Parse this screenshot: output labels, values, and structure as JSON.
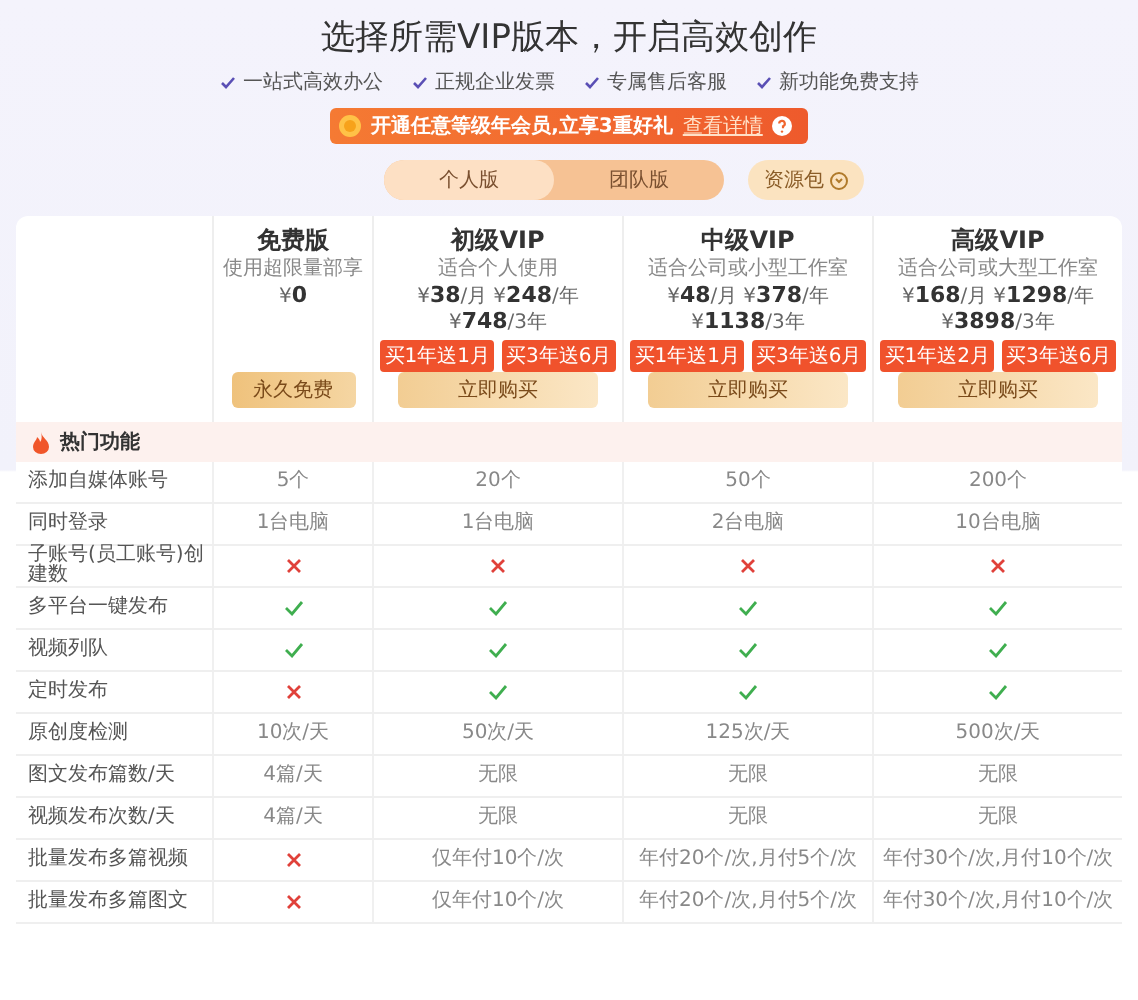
{
  "header": {
    "title": "选择所需VIP版本，开启高效创作",
    "features": [
      "一站式高效办公",
      "正规企业发票",
      "专属售后客服",
      "新功能免费支持"
    ]
  },
  "promo": {
    "text": "开通任意等级年会员,立享3重好礼",
    "link": "查看详情"
  },
  "edition_tabs": [
    {
      "label": "个人版",
      "selected": true
    },
    {
      "label": "团队版",
      "selected": false
    }
  ],
  "resource_pack": {
    "label": "资源包"
  },
  "plans": [
    {
      "name": "免费版",
      "subtitle": "使用超限量部享",
      "prices": [
        {
          "currency": "¥",
          "amount": "0"
        }
      ],
      "button": "永久免费",
      "free": true
    },
    {
      "name": "初级VIP",
      "subtitle": "适合个人使用",
      "prices": [
        {
          "currency": "¥",
          "amount": "38",
          "unit": "/月"
        },
        {
          "currency": "¥",
          "amount": "248",
          "unit": "/年"
        },
        {
          "currency": "¥",
          "amount": "748",
          "unit": "/3年"
        }
      ],
      "offers": [
        "买1年送1月",
        "买3年送6月"
      ],
      "button": "立即购买",
      "free": false
    },
    {
      "name": "中级VIP",
      "subtitle": "适合公司或小型工作室",
      "prices": [
        {
          "currency": "¥",
          "amount": "48",
          "unit": "/月"
        },
        {
          "currency": "¥",
          "amount": "378",
          "unit": "/年"
        },
        {
          "currency": "¥",
          "amount": "1138",
          "unit": "/3年"
        }
      ],
      "offers": [
        "买1年送1月",
        "买3年送6月"
      ],
      "button": "立即购买",
      "free": false
    },
    {
      "name": "高级VIP",
      "subtitle": "适合公司或大型工作室",
      "prices": [
        {
          "currency": "¥",
          "amount": "168",
          "unit": "/月"
        },
        {
          "currency": "¥",
          "amount": "1298",
          "unit": "/年"
        },
        {
          "currency": "¥",
          "amount": "3898",
          "unit": "/3年"
        }
      ],
      "offers": [
        "买1年送2月",
        "买3年送6月"
      ],
      "button": "立即购买",
      "free": false
    }
  ],
  "section": {
    "title": "热门功能"
  },
  "rows": [
    {
      "label": "添加自媒体账号",
      "cells": [
        {
          "kind": "text",
          "text": "5个"
        },
        {
          "kind": "text",
          "text": "20个"
        },
        {
          "kind": "text",
          "text": "50个"
        },
        {
          "kind": "text",
          "text": "200个"
        }
      ]
    },
    {
      "label": "同时登录",
      "cells": [
        {
          "kind": "text",
          "text": "1台电脑"
        },
        {
          "kind": "text",
          "text": "1台电脑"
        },
        {
          "kind": "text",
          "text": "2台电脑"
        },
        {
          "kind": "text",
          "text": "10台电脑"
        }
      ]
    },
    {
      "label": "子账号(员工账号)创建数",
      "cells": [
        {
          "kind": "cross"
        },
        {
          "kind": "cross"
        },
        {
          "kind": "cross"
        },
        {
          "kind": "cross"
        }
      ]
    },
    {
      "label": "多平台一键发布",
      "cells": [
        {
          "kind": "check"
        },
        {
          "kind": "check"
        },
        {
          "kind": "check"
        },
        {
          "kind": "check"
        }
      ]
    },
    {
      "label": "视频列队",
      "cells": [
        {
          "kind": "check"
        },
        {
          "kind": "check"
        },
        {
          "kind": "check"
        },
        {
          "kind": "check"
        }
      ]
    },
    {
      "label": "定时发布",
      "cells": [
        {
          "kind": "cross"
        },
        {
          "kind": "check"
        },
        {
          "kind": "check"
        },
        {
          "kind": "check"
        }
      ]
    },
    {
      "label": "原创度检测",
      "cells": [
        {
          "kind": "text",
          "text": "10次/天"
        },
        {
          "kind": "text",
          "text": "50次/天"
        },
        {
          "kind": "text",
          "text": "125次/天"
        },
        {
          "kind": "text",
          "text": "500次/天"
        }
      ]
    },
    {
      "label": "图文发布篇数/天",
      "cells": [
        {
          "kind": "text",
          "text": "4篇/天"
        },
        {
          "kind": "text",
          "text": "无限"
        },
        {
          "kind": "text",
          "text": "无限"
        },
        {
          "kind": "text",
          "text": "无限"
        }
      ]
    },
    {
      "label": "视频发布次数/天",
      "cells": [
        {
          "kind": "text",
          "text": "4篇/天"
        },
        {
          "kind": "text",
          "text": "无限"
        },
        {
          "kind": "text",
          "text": "无限"
        },
        {
          "kind": "text",
          "text": "无限"
        }
      ]
    },
    {
      "label": "批量发布多篇视频",
      "cells": [
        {
          "kind": "cross"
        },
        {
          "kind": "text",
          "text": "仅年付10个/次"
        },
        {
          "kind": "text",
          "text": "年付20个/次,月付5个/次"
        },
        {
          "kind": "text",
          "text": "年付30个/次,月付10个/次"
        }
      ]
    },
    {
      "label": "批量发布多篇图文",
      "cells": [
        {
          "kind": "cross"
        },
        {
          "kind": "text",
          "text": "仅年付10个/次"
        },
        {
          "kind": "text",
          "text": "年付20个/次,月付5个/次"
        },
        {
          "kind": "text",
          "text": "年付30个/次,月付10个/次"
        }
      ]
    }
  ]
}
